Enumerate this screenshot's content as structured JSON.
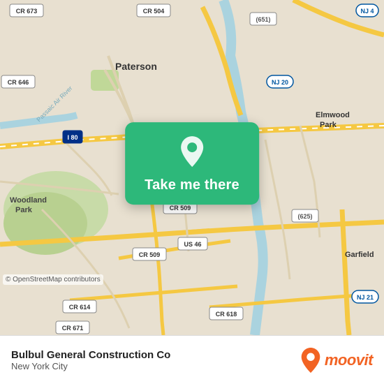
{
  "map": {
    "alt": "Map of Paterson area, New York City",
    "copyright": "© OpenStreetMap contributors"
  },
  "overlay": {
    "button_label": "Take me there",
    "pin_icon": "location-pin"
  },
  "bottom_bar": {
    "place_name": "Bulbul General Construction Co",
    "city_name": "New York City"
  },
  "moovit": {
    "logo_text": "moovit",
    "logo_alt": "Moovit logo"
  }
}
